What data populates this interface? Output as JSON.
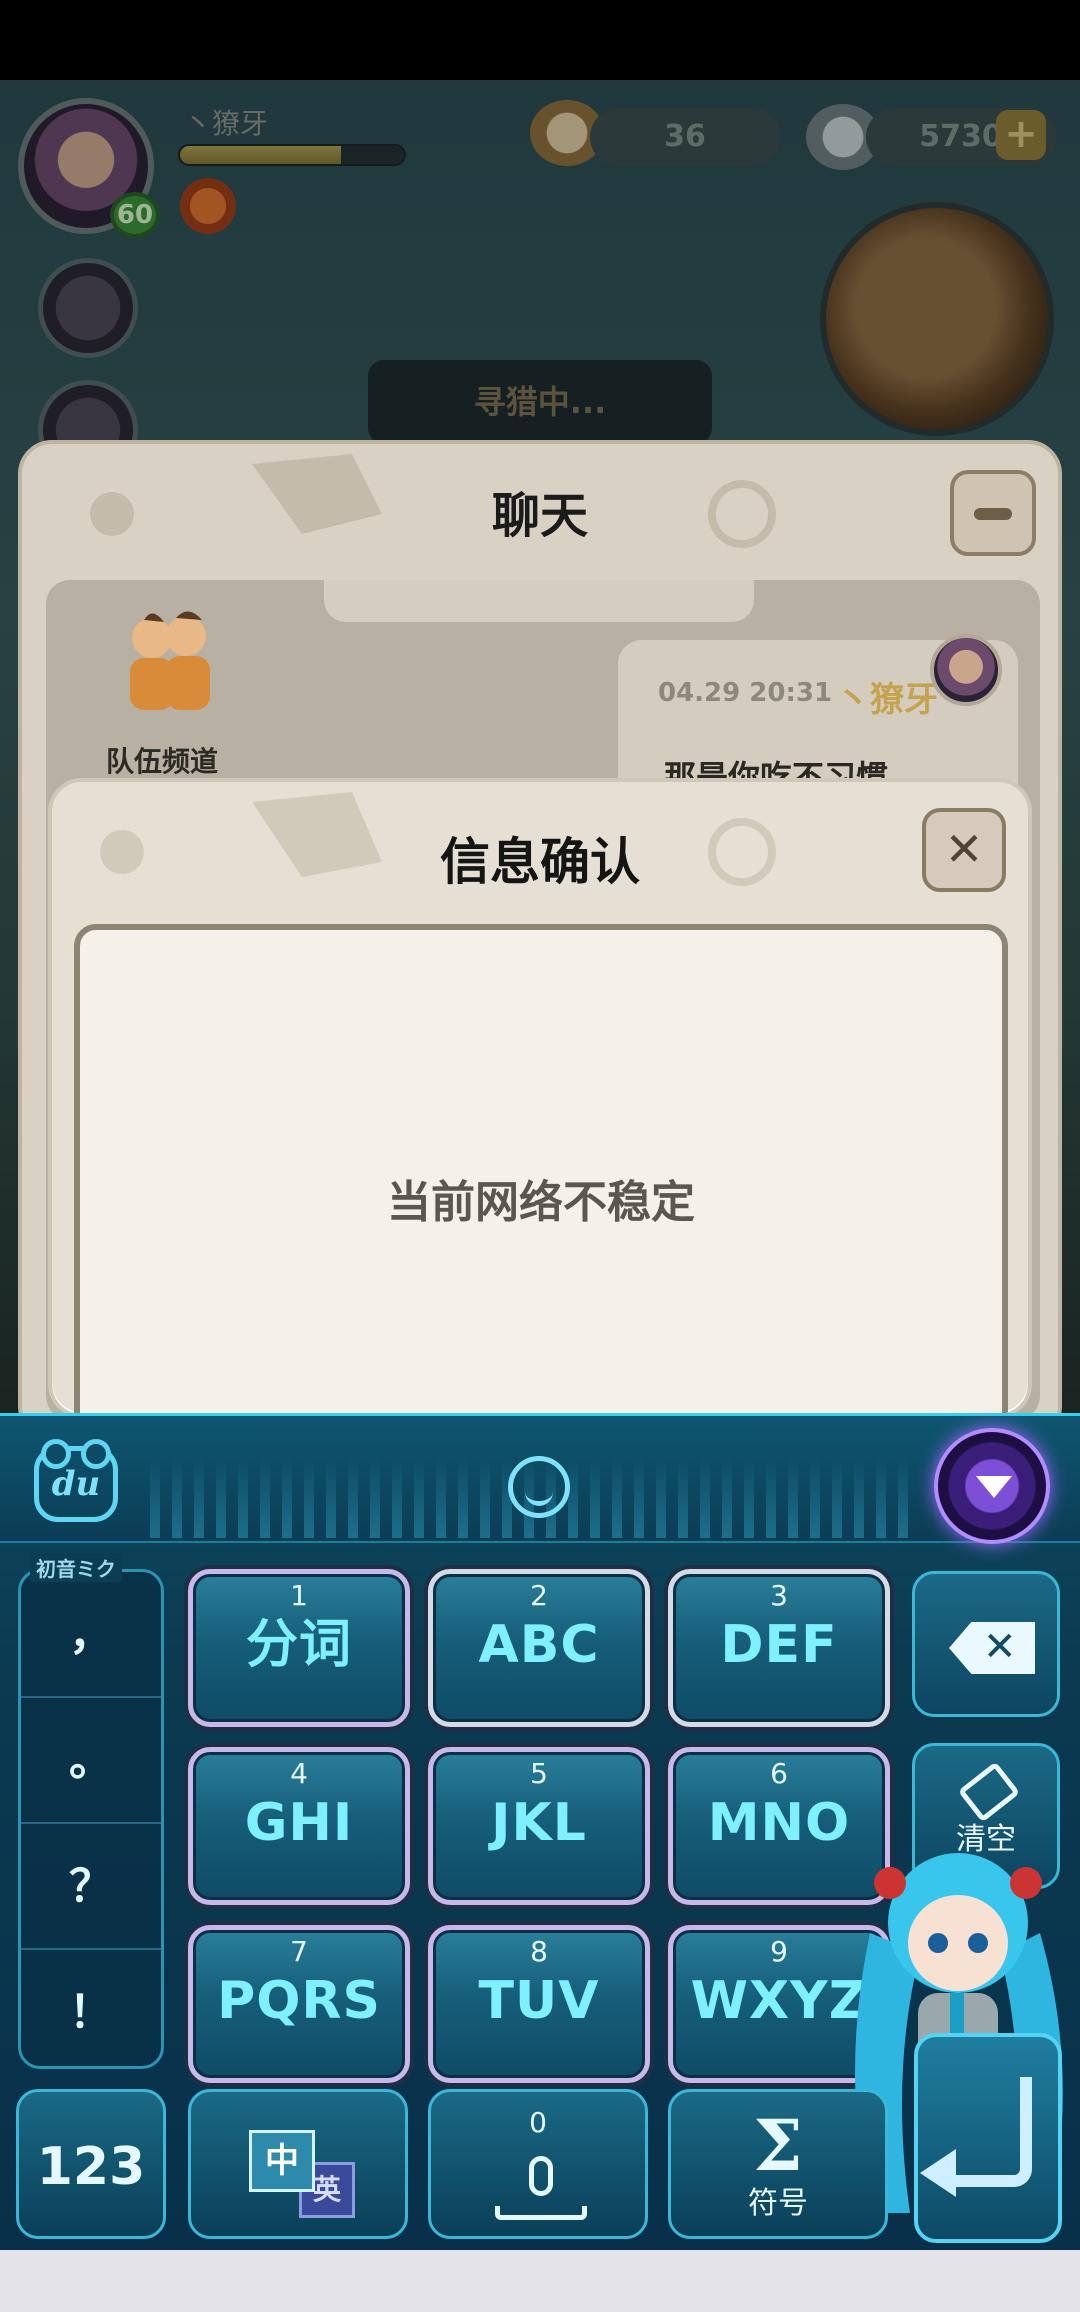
{
  "game": {
    "player_name": "丶獠牙",
    "level": "60",
    "xp_fraction": 0.72,
    "currency_1": "36",
    "currency_2": "5730",
    "plus": "+",
    "hunt_status": "寻猎中..."
  },
  "chat": {
    "title": "聊天",
    "channel_label": "队伍频道",
    "message": {
      "time": "04.29 20:31",
      "sender": "丶獠牙",
      "text": "那是你吃不习惯"
    }
  },
  "dialog": {
    "title": "信息确认",
    "close": "✕",
    "message": "当前网络不稳定"
  },
  "keyboard": {
    "logo": "du",
    "theme_label": "初音ミク",
    "punctuation": [
      "，",
      "。",
      "？",
      "！"
    ],
    "keys": [
      {
        "num": "1",
        "letters": "分词"
      },
      {
        "num": "2",
        "letters": "ABC"
      },
      {
        "num": "3",
        "letters": "DEF"
      },
      {
        "num": "4",
        "letters": "GHI"
      },
      {
        "num": "5",
        "letters": "JKL"
      },
      {
        "num": "6",
        "letters": "MNO"
      },
      {
        "num": "7",
        "letters": "PQRS"
      },
      {
        "num": "8",
        "letters": "TUV"
      },
      {
        "num": "9",
        "letters": "WXYZ"
      }
    ],
    "clear_label": "清空",
    "num_mode_label": "123",
    "lang_zh": "中",
    "lang_en": "英",
    "space_num": "0",
    "symbol_icon": "Σ",
    "symbol_label": "符号"
  },
  "icons": {
    "backspace": "backspace-icon",
    "enter": "enter-icon",
    "mic": "mic-icon",
    "emoji": "emoji-icon",
    "collapse": "collapse-keyboard-icon"
  },
  "colors": {
    "key_letters": "#7ff0ff",
    "keyboard_bg": "#0b3a51",
    "dialog_bg": "#e6e0d4",
    "sender_name": "#c5a24e"
  }
}
